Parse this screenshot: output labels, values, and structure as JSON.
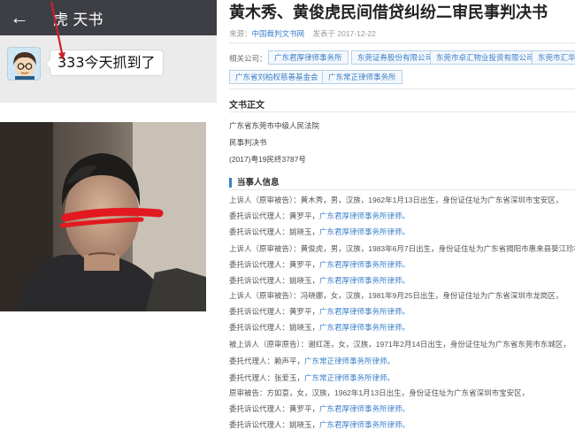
{
  "chat": {
    "title": "虎 天书",
    "back_icon": "arrow-left-icon",
    "message": "333今天抓到了",
    "colors": {
      "header": "#3d3f45",
      "body": "#ebebeb",
      "arrow": "#d01f2a"
    }
  },
  "document": {
    "title": "黄木秀、黄俊虎民间借贷纠纷二审民事判决书",
    "meta": {
      "source_label": "来源：",
      "source": "中国裁判文书网",
      "date": "发表于 2017-12-22"
    },
    "related_label": "相关公司：",
    "tags": [
      "广东君厚律师事务所",
      "东莞证券股份有限公司",
      "东莞市卓汇物业投资有限公司",
      "东莞市汇华",
      "广东省刘柏权慈善基金会",
      "广东常正律师事务所"
    ],
    "section_title": "文书正文",
    "header_lines": [
      "广东省东莞市中级人民法院",
      "民事判决书",
      "(2017)粤19民终3787号"
    ],
    "parties_title": "当事人信息",
    "parties": [
      {
        "text": "上诉人（原审被告）：黄木秀，男，汉族，1962年1月13日出生，身份证住址为广东省深圳市宝安区，",
        "link": ""
      },
      {
        "text": "委托诉讼代理人：黄罗平，",
        "link": "广东君厚律师事务所律师。"
      },
      {
        "text": "委托诉讼代理人：姚晓玉，",
        "link": "广东君厚律师事务所律师。"
      },
      {
        "text": "上诉人（原审被告）：黄俊虎，男，汉族，1983年6月7日出生，身份证住址为广东省揭阳市惠来县葵江珍柿内",
        "link": ""
      },
      {
        "text": "委托诉讼代理人：黄罗平，",
        "link": "广东君厚律师事务所律师。"
      },
      {
        "text": "委托诉讼代理人：姚晓玉，",
        "link": "广东君厚律师事务所律师。"
      },
      {
        "text": "上诉人（原审被告）：冯晓娜，女，汉族，1981年9月25日出生，身份证住址为广东省深圳市龙岗区，",
        "link": ""
      },
      {
        "text": "委托诉讼代理人：黄罗平，",
        "link": "广东君厚律师事务所律师。"
      },
      {
        "text": "委托诉讼代理人：姚晓玉，",
        "link": "广东君厚律师事务所律师。"
      },
      {
        "text": "被上诉人（原审原告）：谢红莲，女，汉族，1971年2月14日出生，身份证住址为广东省东莞市东城区，",
        "link": ""
      },
      {
        "text": "委托代理人：赖声平，",
        "link": "广东常正律师事务所律师。"
      },
      {
        "text": "委托代理人：张爱玉，",
        "link": "广东常正律师事务所律师。"
      },
      {
        "text": "原审被告：方如意，女，汉族，1962年1月13日出生，身份证住址为广东省深圳市宝安区，",
        "link": ""
      },
      {
        "text": "委托诉讼代理人：黄罗平，",
        "link": "广东君厚律师事务所律师。"
      },
      {
        "text": "委托诉讼代理人：姚晓玉，",
        "link": "广东君厚律师事务所律师。"
      }
    ],
    "colors": {
      "link": "#3b7fc9",
      "tag_border": "#b7cfe8"
    }
  }
}
